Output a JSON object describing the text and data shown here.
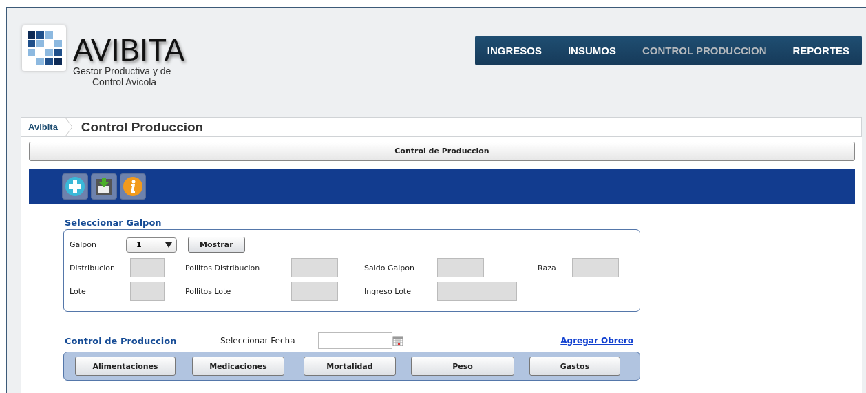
{
  "logo": {
    "title": "AVIBITA",
    "subtitle_line_1": "Gestor Productiva y de",
    "subtitle_line_2": "Control Avicola"
  },
  "nav": [
    {
      "label": "INGRESOS",
      "selected": false
    },
    {
      "label": "INSUMOS",
      "selected": false
    },
    {
      "label": "CONTROL PRODUCCION",
      "selected": true
    },
    {
      "label": "REPORTES",
      "selected": false
    }
  ],
  "breadcrumb": {
    "home": "Avibita",
    "current": "Control Produccion"
  },
  "panel_title": "Control de Produccion",
  "toolbar": [
    {
      "kind": "add"
    },
    {
      "kind": "save"
    },
    {
      "kind": "info"
    }
  ],
  "galpon_section": {
    "title": "Seleccionar Galpon",
    "galpon_label": "Galpon",
    "galpon_value": "1",
    "show_button": "Mostrar",
    "fields": [
      {
        "label": "Distribucion"
      },
      {
        "label": "Pollitos Distribucion"
      },
      {
        "label": "Saldo Galpon"
      },
      {
        "label": "Raza"
      },
      {
        "label": "Lote"
      },
      {
        "label": "Pollitos Lote"
      },
      {
        "label": "Ingreso Lote"
      }
    ]
  },
  "control_section": {
    "title": "Control de Produccion",
    "date_label": "Seleccionar Fecha",
    "link": "Agregar Obrero",
    "buttons": [
      "Alimentaciones",
      "Medicaciones",
      "Mortalidad",
      "Peso",
      "Gastos"
    ]
  }
}
